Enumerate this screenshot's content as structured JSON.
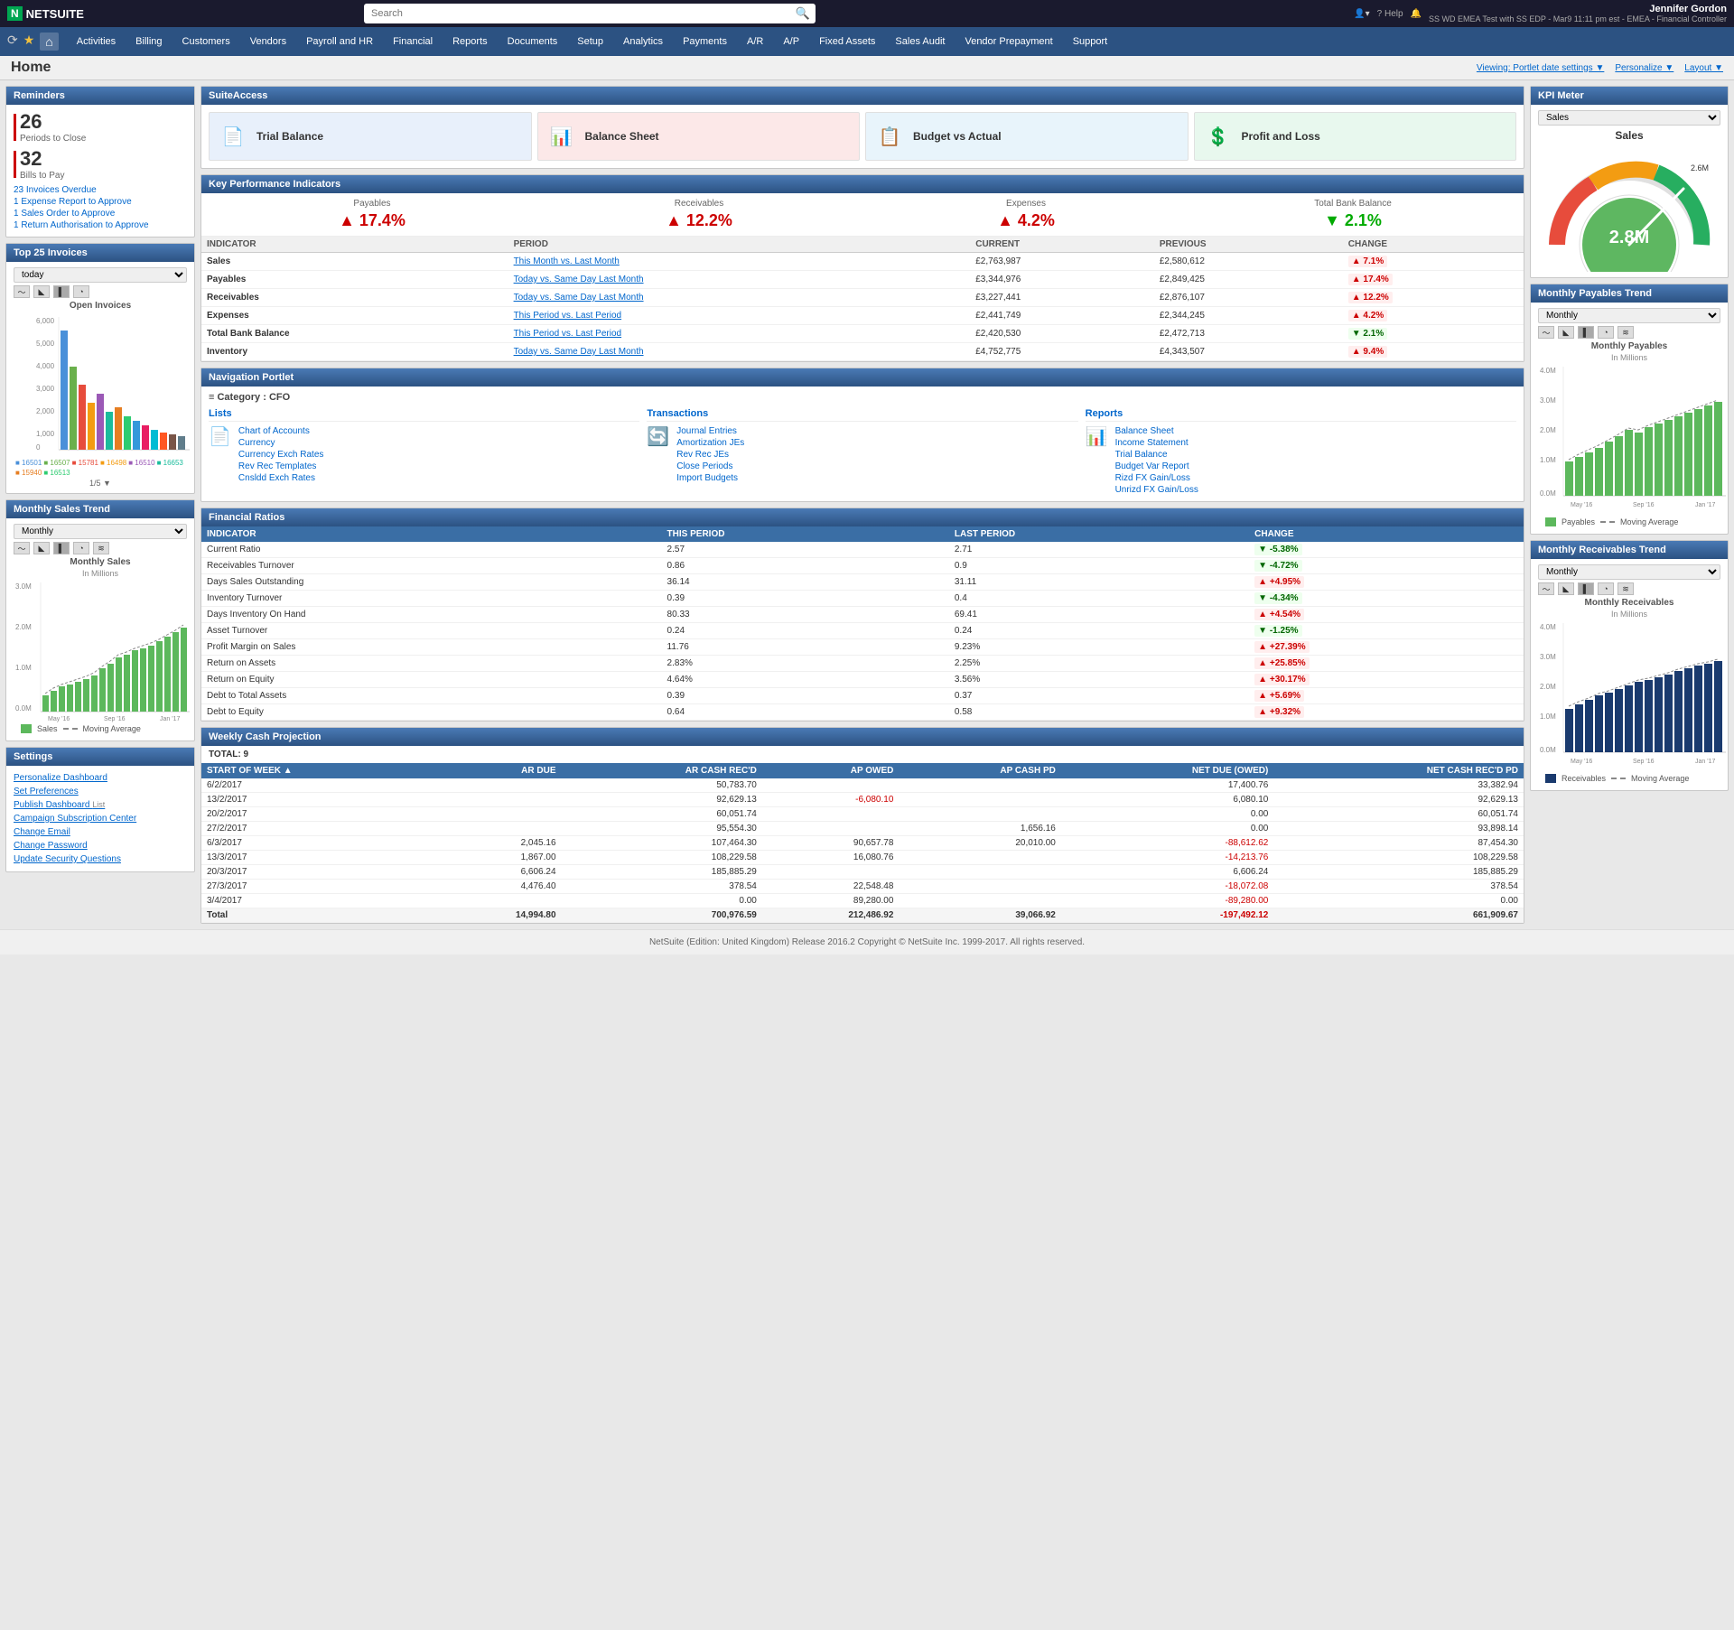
{
  "topbar": {
    "logo": "NETSUITE",
    "logo_n": "N",
    "search_placeholder": "Search",
    "user_name": "Jennifer Gordon",
    "user_detail": "SS WD EMEA Test with SS EDP - Mar9 11:11 pm est - EMEA - Financial Controller",
    "help": "Help"
  },
  "navbar": {
    "items": [
      "Activities",
      "Billing",
      "Customers",
      "Vendors",
      "Payroll and HR",
      "Financial",
      "Reports",
      "Documents",
      "Setup",
      "Analytics",
      "Payments",
      "A/R",
      "A/P",
      "Fixed Assets",
      "Sales Audit",
      "Vendor Prepayment",
      "Support"
    ]
  },
  "page": {
    "title": "Home",
    "viewing": "Viewing: Portlet date settings ▼",
    "personalize": "Personalize ▼",
    "layout": "Layout ▼"
  },
  "reminders": {
    "title": "Reminders",
    "periods": "26",
    "periods_label": "Periods to Close",
    "bills": "32",
    "bills_label": "Bills to Pay",
    "links": [
      "23 Invoices Overdue",
      "1 Expense Report to Approve",
      "1 Sales Order to Approve",
      "1 Return Authorisation to Approve"
    ]
  },
  "top25": {
    "title": "Top 25 Invoices",
    "period": "today",
    "chart_title": "Open Invoices",
    "y_labels": [
      "6,000",
      "5,000",
      "4,000",
      "3,000",
      "2,000",
      "1,000",
      "0"
    ],
    "legend_items": [
      "16501",
      "16507",
      "15781",
      "16498",
      "16510",
      "16653",
      "15940",
      "16513"
    ],
    "page_info": "1/5"
  },
  "monthly_sales": {
    "title": "Monthly Sales Trend",
    "period": "Monthly",
    "chart_title": "Monthly Sales",
    "chart_sub": "In Millions",
    "y_labels": [
      "3.0M",
      "2.0M",
      "1.0M",
      "0.0M"
    ],
    "x_labels": [
      "May '16",
      "Sep '16",
      "Jan '17"
    ],
    "legend_sales": "Sales",
    "legend_ma": "Moving Average"
  },
  "settings": {
    "title": "Settings",
    "links": [
      "Personalize Dashboard",
      "Set Preferences",
      "Publish Dashboard List",
      "Campaign Subscription Center",
      "Change Email",
      "Change Password",
      "Update Security Questions"
    ]
  },
  "suite_access": {
    "title": "SuiteAccess",
    "cards": [
      {
        "label": "Trial Balance",
        "color": "blue",
        "icon": "📄"
      },
      {
        "label": "Balance Sheet",
        "color": "pink",
        "icon": "📊"
      },
      {
        "label": "Budget vs Actual",
        "color": "lblue",
        "icon": "📋"
      },
      {
        "label": "Profit and Loss",
        "color": "green",
        "icon": "💲"
      }
    ]
  },
  "kpi": {
    "title": "Key Performance Indicators",
    "metrics": [
      {
        "label": "Payables",
        "value": "17.4%",
        "direction": "up"
      },
      {
        "label": "Receivables",
        "value": "12.2%",
        "direction": "up"
      },
      {
        "label": "Expenses",
        "value": "4.2%",
        "direction": "up"
      },
      {
        "label": "Total Bank Balance",
        "value": "2.1%",
        "direction": "down"
      }
    ],
    "table_headers": [
      "INDICATOR",
      "PERIOD",
      "CURRENT",
      "PREVIOUS",
      "CHANGE"
    ],
    "rows": [
      {
        "indicator": "Sales",
        "period": "This Month vs. Last Month",
        "current": "£2,763,987",
        "previous": "£2,580,612",
        "change": "7.1%",
        "dir": "up"
      },
      {
        "indicator": "Payables",
        "period": "Today vs. Same Day Last Month",
        "current": "£3,344,976",
        "previous": "£2,849,425",
        "change": "17.4%",
        "dir": "up"
      },
      {
        "indicator": "Receivables",
        "period": "Today vs. Same Day Last Month",
        "current": "£3,227,441",
        "previous": "£2,876,107",
        "change": "12.2%",
        "dir": "up"
      },
      {
        "indicator": "Expenses",
        "period": "This Period vs. Last Period",
        "current": "£2,441,749",
        "previous": "£2,344,245",
        "change": "4.2%",
        "dir": "up"
      },
      {
        "indicator": "Total Bank Balance",
        "period": "This Period vs. Last Period",
        "current": "£2,420,530",
        "previous": "£2,472,713",
        "change": "2.1%",
        "dir": "down"
      },
      {
        "indicator": "Inventory",
        "period": "Today vs. Same Day Last Month",
        "current": "£4,752,775",
        "previous": "£4,343,507",
        "change": "9.4%",
        "dir": "up"
      }
    ]
  },
  "nav_portlet": {
    "title": "Navigation Portlet",
    "category": "Category : CFO",
    "lists_title": "Lists",
    "lists": [
      "Chart of Accounts",
      "Currency",
      "Currency Exch Rates",
      "Rev Rec Templates",
      "Cnsldd Exch Rates"
    ],
    "trans_title": "Transactions",
    "trans": [
      "Journal Entries",
      "Amortization JEs",
      "Rev Rec JEs",
      "Close Periods",
      "Import Budgets"
    ],
    "reports_title": "Reports",
    "reports": [
      "Balance Sheet",
      "Income Statement",
      "Trial Balance",
      "Budget Var Report",
      "Rizd FX Gain/Loss",
      "Unrizd FX Gain/Loss"
    ]
  },
  "financial_ratios": {
    "title": "Financial Ratios",
    "headers": [
      "INDICATOR",
      "THIS PERIOD",
      "LAST PERIOD",
      "CHANGE"
    ],
    "rows": [
      {
        "indicator": "Current Ratio",
        "this": "2.57",
        "last": "2.71",
        "change": "-5.38%",
        "dir": "down"
      },
      {
        "indicator": "Receivables Turnover",
        "this": "0.86",
        "last": "0.9",
        "change": "-4.72%",
        "dir": "down"
      },
      {
        "indicator": "Days Sales Outstanding",
        "this": "36.14",
        "last": "31.11",
        "change": "+4.95%",
        "dir": "up"
      },
      {
        "indicator": "Inventory Turnover",
        "this": "0.39",
        "last": "0.4",
        "change": "-4.34%",
        "dir": "down"
      },
      {
        "indicator": "Days Inventory On Hand",
        "this": "80.33",
        "last": "69.41",
        "change": "+4.54%",
        "dir": "up"
      },
      {
        "indicator": "Asset Turnover",
        "this": "0.24",
        "last": "0.24",
        "change": "-1.25%",
        "dir": "down"
      },
      {
        "indicator": "Profit Margin on Sales",
        "this": "11.76",
        "last": "9.23%",
        "change": "+27.39%",
        "dir": "up"
      },
      {
        "indicator": "Return on Assets",
        "this": "2.83%",
        "last": "2.25%",
        "change": "+25.85%",
        "dir": "up"
      },
      {
        "indicator": "Return on Equity",
        "this": "4.64%",
        "last": "3.56%",
        "change": "+30.17%",
        "dir": "up"
      },
      {
        "indicator": "Debt to Total Assets",
        "this": "0.39",
        "last": "0.37",
        "change": "+5.69%",
        "dir": "up"
      },
      {
        "indicator": "Debt to Equity",
        "this": "0.64",
        "last": "0.58",
        "change": "+9.32%",
        "dir": "up"
      }
    ]
  },
  "cash_projection": {
    "title": "Weekly Cash Projection",
    "total": "TOTAL: 9",
    "headers": [
      "START OF WEEK ▲",
      "AR DUE",
      "AR CASH REC'D",
      "AP OWED",
      "AP CASH PD",
      "NET DUE (OWED)",
      "NET CASH REC'D PD"
    ],
    "rows": [
      {
        "week": "6/2/2017",
        "ar_due": "",
        "ar_cash": "50,783.70",
        "ap_owed": "",
        "ap_cash": "",
        "net_due": "17,400.76",
        "net_cash": "33,382.94"
      },
      {
        "week": "13/2/2017",
        "ar_due": "",
        "ar_cash": "92,629.13",
        "ap_owed": "-6,080.10",
        "ap_cash": "",
        "net_due": "6,080.10",
        "net_cash": "92,629.13"
      },
      {
        "week": "20/2/2017",
        "ar_due": "",
        "ar_cash": "60,051.74",
        "ap_owed": "",
        "ap_cash": "",
        "net_due": "0.00",
        "net_cash": "60,051.74"
      },
      {
        "week": "27/2/2017",
        "ar_due": "",
        "ar_cash": "95,554.30",
        "ap_owed": "",
        "ap_cash": "1,656.16",
        "net_due": "0.00",
        "net_cash": "93,898.14"
      },
      {
        "week": "6/3/2017",
        "ar_due": "2,045.16",
        "ar_cash": "107,464.30",
        "ap_owed": "90,657.78",
        "ap_cash": "20,010.00",
        "net_due": "-88,612.62",
        "net_cash": "87,454.30"
      },
      {
        "week": "13/3/2017",
        "ar_due": "1,867.00",
        "ar_cash": "108,229.58",
        "ap_owed": "16,080.76",
        "ap_cash": "",
        "net_due": "-14,213.76",
        "net_cash": "108,229.58"
      },
      {
        "week": "20/3/2017",
        "ar_due": "6,606.24",
        "ar_cash": "185,885.29",
        "ap_owed": "",
        "ap_cash": "",
        "net_due": "6,606.24",
        "net_cash": "185,885.29"
      },
      {
        "week": "27/3/2017",
        "ar_due": "4,476.40",
        "ar_cash": "378.54",
        "ap_owed": "22,548.48",
        "ap_cash": "",
        "net_due": "-18,072.08",
        "net_cash": "378.54"
      },
      {
        "week": "3/4/2017",
        "ar_due": "",
        "ar_cash": "0.00",
        "ap_owed": "89,280.00",
        "ap_cash": "",
        "net_due": "-89,280.00",
        "net_cash": "0.00"
      },
      {
        "week": "Total",
        "ar_due": "14,994.80",
        "ar_cash": "700,976.59",
        "ap_owed": "212,486.92",
        "ap_cash": "39,066.92",
        "net_due": "-197,492.12",
        "net_cash": "661,909.67",
        "is_total": true
      }
    ]
  },
  "kpi_meter": {
    "title": "KPI Meter",
    "dropdown": "Sales",
    "chart_label": "Sales",
    "value": "2.8M",
    "max_label": "2.6M"
  },
  "monthly_payables": {
    "title": "Monthly Payables Trend",
    "period": "Monthly",
    "chart_title": "Monthly Payables",
    "chart_sub": "In Millions",
    "y_labels": [
      "4.0M",
      "3.0M",
      "2.0M",
      "1.0M",
      "0.0M"
    ],
    "x_labels": [
      "May '16",
      "Sep '16",
      "Jan '17"
    ],
    "legend_payables": "Payables",
    "legend_ma": "Moving Average"
  },
  "monthly_receivables": {
    "title": "Monthly Receivables Trend",
    "period": "Monthly",
    "chart_title": "Monthly Receivables",
    "chart_sub": "In Millions",
    "y_labels": [
      "4.0M",
      "3.0M",
      "2.0M",
      "1.0M",
      "0.0M"
    ],
    "x_labels": [
      "May '16",
      "Sep '16",
      "Jan '17"
    ],
    "legend_receivables": "Receivables",
    "legend_ma": "Moving Average"
  },
  "footer": {
    "text": "NetSuite (Edition: United Kingdom) Release 2016.2 Copyright © NetSuite Inc. 1999-2017. All rights reserved."
  }
}
